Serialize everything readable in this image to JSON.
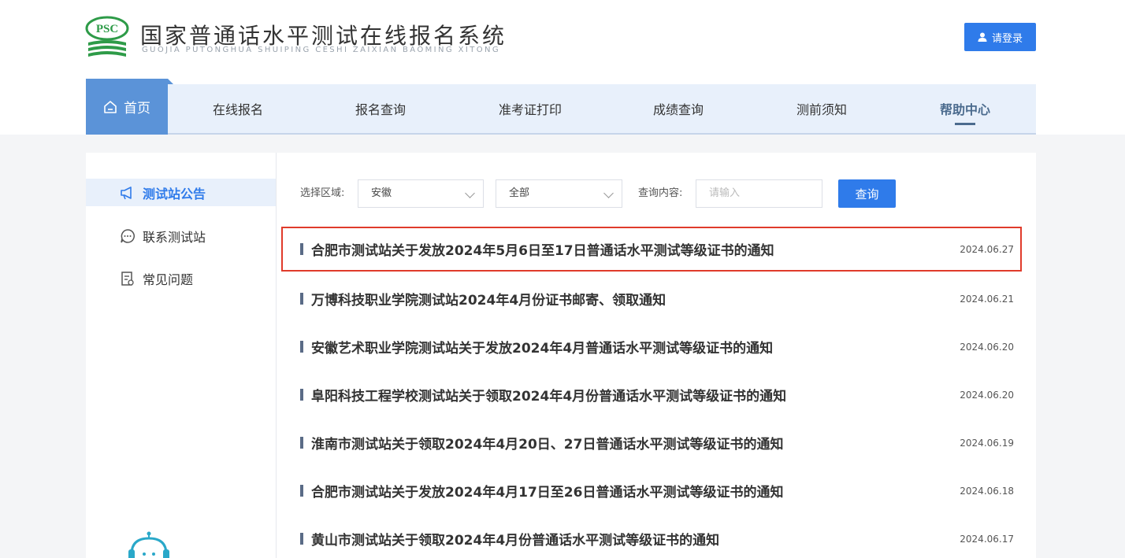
{
  "header": {
    "logo_abbr": "PSC",
    "title": "国家普通话水平测试在线报名系统",
    "subtitle": "GUOJIA PUTONGHUA SHUIPING CESHI ZAIXIAN BAOMING XITONG",
    "login_label": "请登录"
  },
  "nav": {
    "home": "首页",
    "items": [
      "在线报名",
      "报名查询",
      "准考证打印",
      "成绩查询",
      "测前须知",
      "帮助中心"
    ],
    "active": "帮助中心"
  },
  "sidebar": {
    "items": [
      "测试站公告",
      "联系测试站",
      "常见问题"
    ]
  },
  "filters": {
    "region_label": "选择区域:",
    "region_value": "安徽",
    "scope_value": "全部",
    "query_label": "查询内容:",
    "query_placeholder": "请输入",
    "search_label": "查询"
  },
  "news": [
    {
      "title": "合肥市测试站关于发放2024年5月6日至17日普通话水平测试等级证书的通知",
      "date": "2024.06.27"
    },
    {
      "title": "万博科技职业学院测试站2024年4月份证书邮寄、领取通知",
      "date": "2024.06.21"
    },
    {
      "title": "安徽艺术职业学院测试站关于发放2024年4月普通话水平测试等级证书的通知",
      "date": "2024.06.20"
    },
    {
      "title": "阜阳科技工程学校测试站关于领取2024年4月份普通话水平测试等级证书的通知",
      "date": "2024.06.20"
    },
    {
      "title": "淮南市测试站关于领取2024年4月20日、27日普通话水平测试等级证书的通知",
      "date": "2024.06.19"
    },
    {
      "title": "合肥市测试站关于发放2024年4月17日至26日普通话水平测试等级证书的通知",
      "date": "2024.06.18"
    },
    {
      "title": "黄山市测试站关于领取2024年4月份普通话水平测试等级证书的通知",
      "date": "2024.06.17"
    }
  ],
  "colors": {
    "primary": "#2f7bea",
    "nav_bg": "#e8f0fb",
    "home_bg": "#5b93d8",
    "logo_green": "#2e9b48",
    "highlight": "#e03b2b"
  }
}
